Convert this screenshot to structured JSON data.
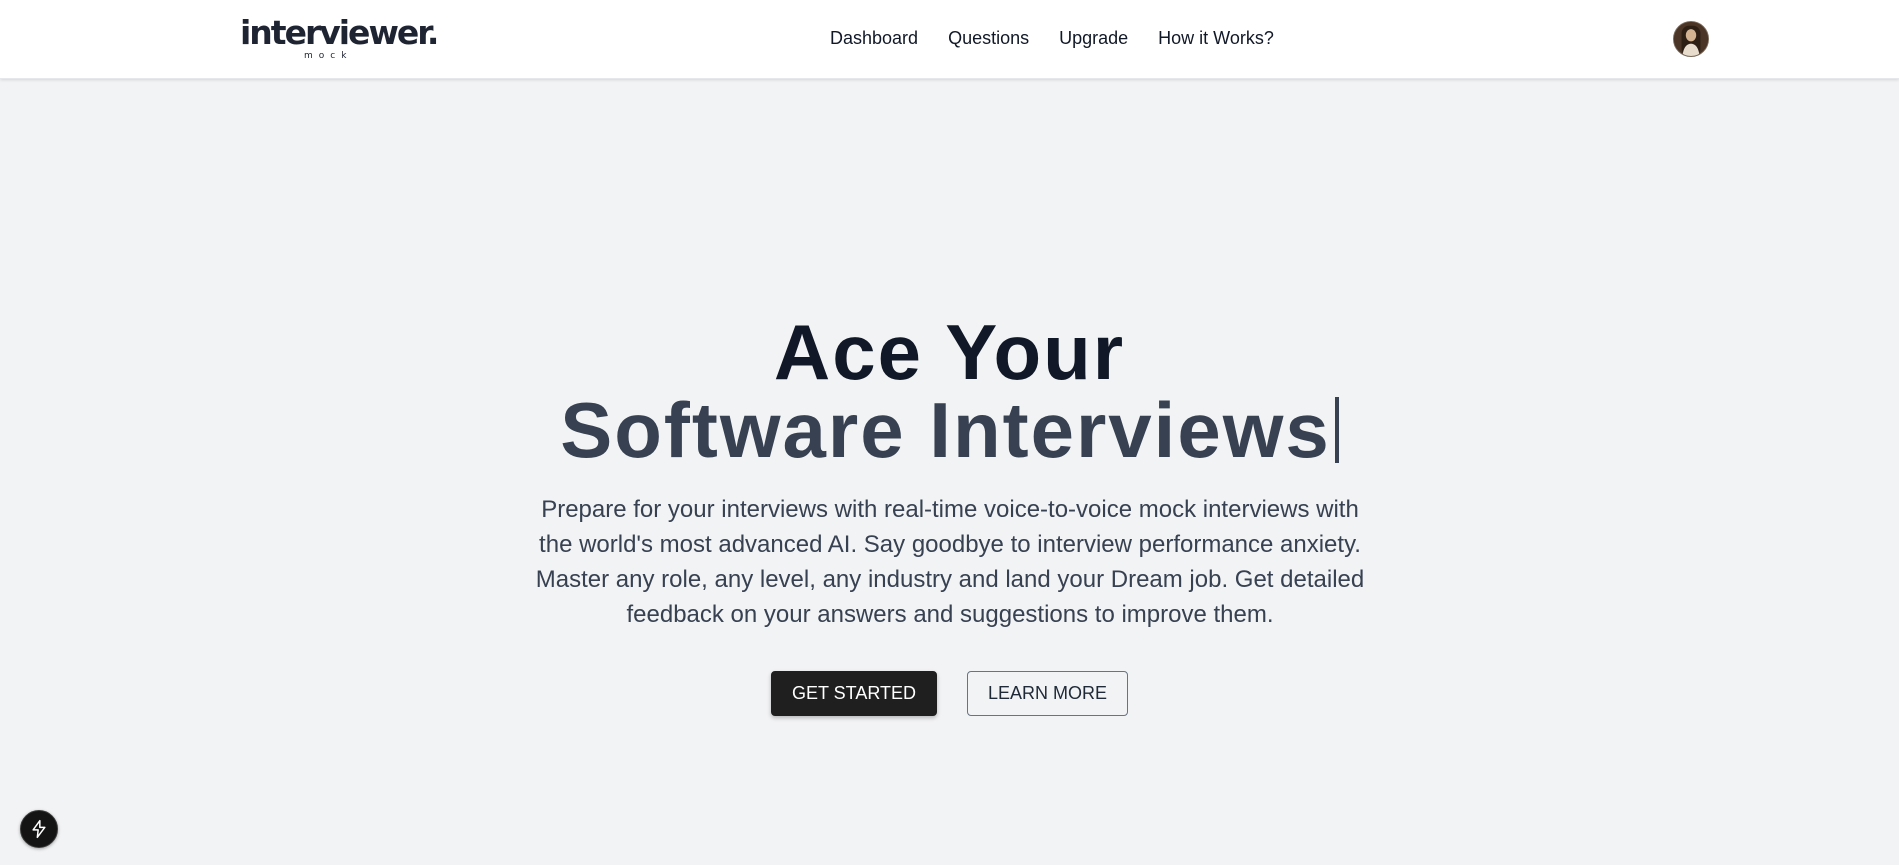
{
  "header": {
    "logo": {
      "word": "interviewer.",
      "sub": "mock"
    },
    "nav": [
      {
        "label": "Dashboard"
      },
      {
        "label": "Questions"
      },
      {
        "label": "Upgrade"
      },
      {
        "label": "How it Works?"
      }
    ],
    "avatar_icon": "user-avatar"
  },
  "hero": {
    "title_line1": "Ace Your",
    "title_line2": "Software Interviews",
    "description": "Prepare for your interviews with real-time voice-to-voice mock interviews with the world's most advanced AI. Say goodbye to interview performance anxiety. Master any role, any level, any industry and land your Dream job. Get detailed feedback on your answers and suggestions to improve them.",
    "primary_button": "GET STARTED",
    "secondary_button": "LEARN MORE"
  },
  "fab": {
    "icon": "lightning-icon"
  },
  "colors": {
    "background": "#f2f3f5",
    "header_bg": "#ffffff",
    "title_dark": "#111827",
    "title_secondary": "#374151",
    "primary_button_bg": "#1f1f1f"
  }
}
